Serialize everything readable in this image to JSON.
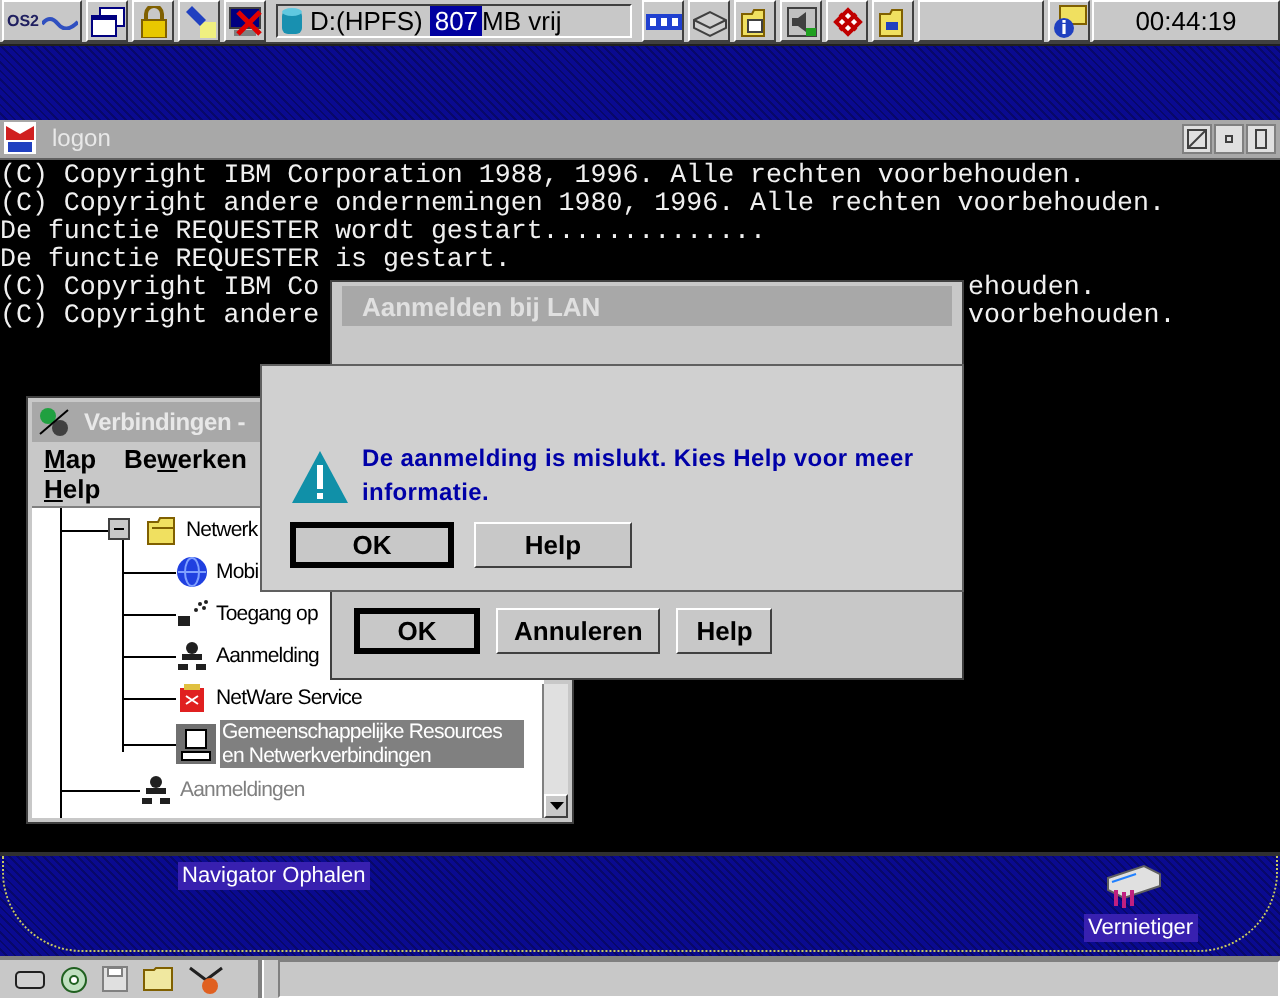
{
  "taskbar": {
    "logo": "OS2",
    "drive_label": "D:(HPFS)",
    "free_amount": "807",
    "free_unit": "MB vrij",
    "clock": "00:44:19"
  },
  "terminal": {
    "title": "logon",
    "lines": [
      {
        "segments": [
          "(C) Copyright IBM Corporation 1988, 1996. Alle rechten voorbehouden."
        ]
      },
      {
        "segments": [
          "(C) Copyright andere ondernemingen 1980, 1996. Alle rechten voorbehouden."
        ]
      },
      {
        "segments": [
          "De functie REQUESTER wordt gestart.............."
        ]
      },
      {
        "segments": [
          "De functie REQUESTER is gestart."
        ]
      },
      {
        "segments": [
          "(C) Copyright IBM Co",
          "ehouden."
        ]
      },
      {
        "segments": [
          "(C) Copyright andere",
          "voorbehouden."
        ]
      }
    ]
  },
  "connections_window": {
    "title": "Verbindingen -",
    "menu": [
      {
        "label": "Map"
      },
      {
        "label": "Bewerken"
      },
      {
        "label": "Help"
      }
    ],
    "tree": [
      {
        "label": "Netwerk",
        "expanded": true,
        "selected": false,
        "dimmed": false,
        "children": [
          {
            "label": "Mobi",
            "selected": false,
            "dimmed": false
          },
          {
            "label": "Toegang op",
            "selected": false,
            "dimmed": false
          },
          {
            "label": "Aanmelding",
            "selected": false,
            "dimmed": false
          },
          {
            "label": "NetWare Service",
            "selected": false,
            "dimmed": false
          },
          {
            "label": "Gemeenschappelijke Resources en Netwerkverbindingen",
            "selected": true,
            "dimmed": false
          }
        ]
      },
      {
        "label": "Aanmeldingen",
        "selected": false,
        "dimmed": true
      }
    ]
  },
  "lan_dialog": {
    "title": "Aanmelden bij LAN",
    "buttons": [
      {
        "label": "OK",
        "default": true
      },
      {
        "label": "Annuleren",
        "default": false
      },
      {
        "label": "Help",
        "default": false
      }
    ]
  },
  "error_box": {
    "message": "De aanmelding is mislukt. Kies Help voor meer informatie.",
    "buttons": [
      {
        "label": "OK",
        "default": true
      },
      {
        "label": "Help",
        "default": false
      }
    ]
  },
  "desktop_icons": [
    {
      "label": "Navigator Ophalen"
    },
    {
      "label": "Vernietiger"
    }
  ]
}
